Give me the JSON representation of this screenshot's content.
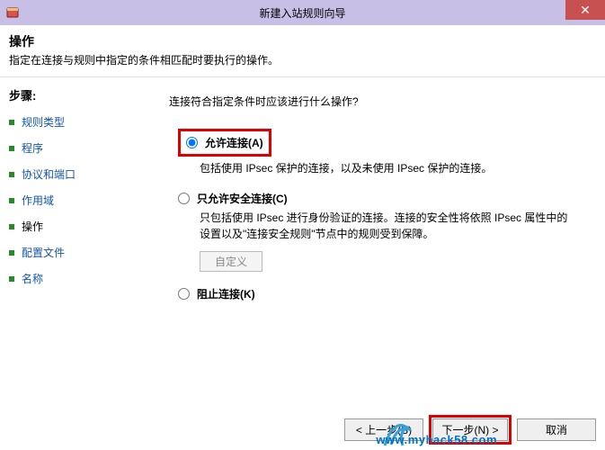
{
  "titlebar": {
    "title": "新建入站规则向导",
    "close_glyph": "✕"
  },
  "header": {
    "title": "操作",
    "desc": "指定在连接与规则中指定的条件相匹配时要执行的操作。"
  },
  "sidebar": {
    "heading": "步骤:",
    "items": [
      {
        "label": "规则类型"
      },
      {
        "label": "程序"
      },
      {
        "label": "协议和端口"
      },
      {
        "label": "作用域"
      },
      {
        "label": "操作",
        "current": true
      },
      {
        "label": "配置文件"
      },
      {
        "label": "名称"
      }
    ]
  },
  "main": {
    "question": "连接符合指定条件时应该进行什么操作?",
    "options": [
      {
        "id": "allow",
        "label": "允许连接(A)",
        "desc": "包括使用 IPsec 保护的连接，以及未使用 IPsec 保护的连接。",
        "selected": true,
        "highlighted": true
      },
      {
        "id": "allow_secure",
        "label": "只允许安全连接(C)",
        "desc": "只包括使用 IPsec 进行身份验证的连接。连接的安全性将依照 IPsec 属性中的设置以及\"连接安全规则\"节点中的规则受到保障。",
        "custom_btn": "自定义"
      },
      {
        "id": "block",
        "label": "阻止连接(K)"
      }
    ]
  },
  "footer": {
    "back": "< 上一步(B)",
    "next": "下一步(N) >",
    "cancel": "取消"
  },
  "watermark": "www.myhack58.com"
}
